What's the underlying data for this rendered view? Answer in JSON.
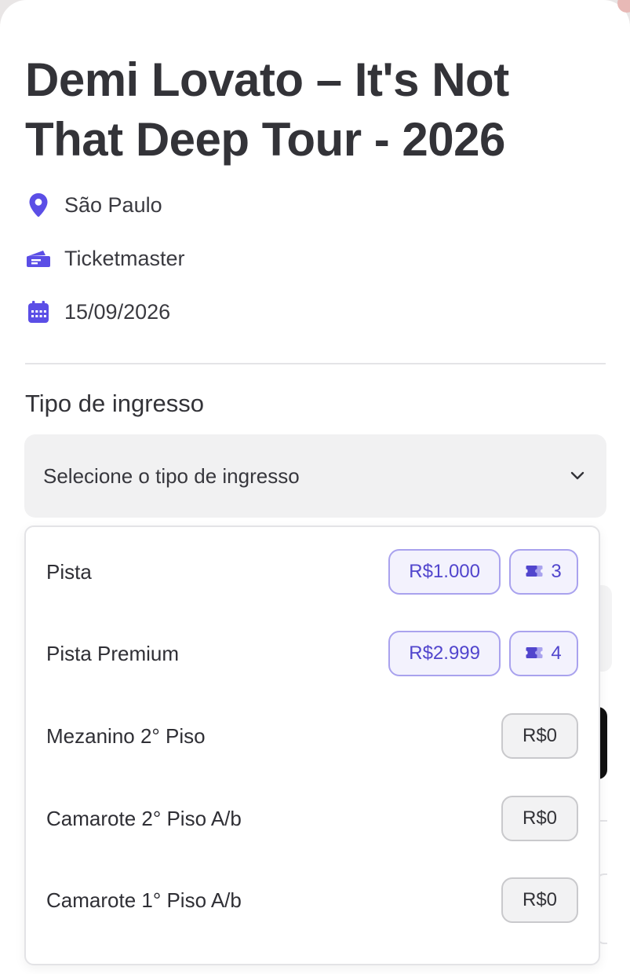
{
  "event": {
    "title": "Demi Lovato – It's Not That Deep Tour - 2026",
    "city": "São Paulo",
    "platform": "Ticketmaster",
    "date": "15/09/2026"
  },
  "icons": {
    "location": "location-pin-icon",
    "platform": "ticket-icon",
    "date": "calendar-icon",
    "dropdown": "chevron-down-icon",
    "count": "ticket-stack-icon"
  },
  "colors": {
    "accent": "#5b4ee6",
    "accent_border": "#a9a2ee",
    "accent_bg": "#f3f2fd",
    "text": "#2f2f35"
  },
  "ticket_type": {
    "label": "Tipo de ingresso",
    "placeholder": "Selecione o tipo de ingresso",
    "options": [
      {
        "name": "Pista",
        "price": "R$1.000",
        "count": "3"
      },
      {
        "name": "Pista Premium",
        "price": "R$2.999",
        "count": "4"
      },
      {
        "name": "Mezanino 2° Piso",
        "price": "R$0"
      },
      {
        "name": "Camarote 2° Piso A/b",
        "price": "R$0"
      },
      {
        "name": "Camarote 1° Piso A/b",
        "price": "R$0"
      }
    ]
  }
}
